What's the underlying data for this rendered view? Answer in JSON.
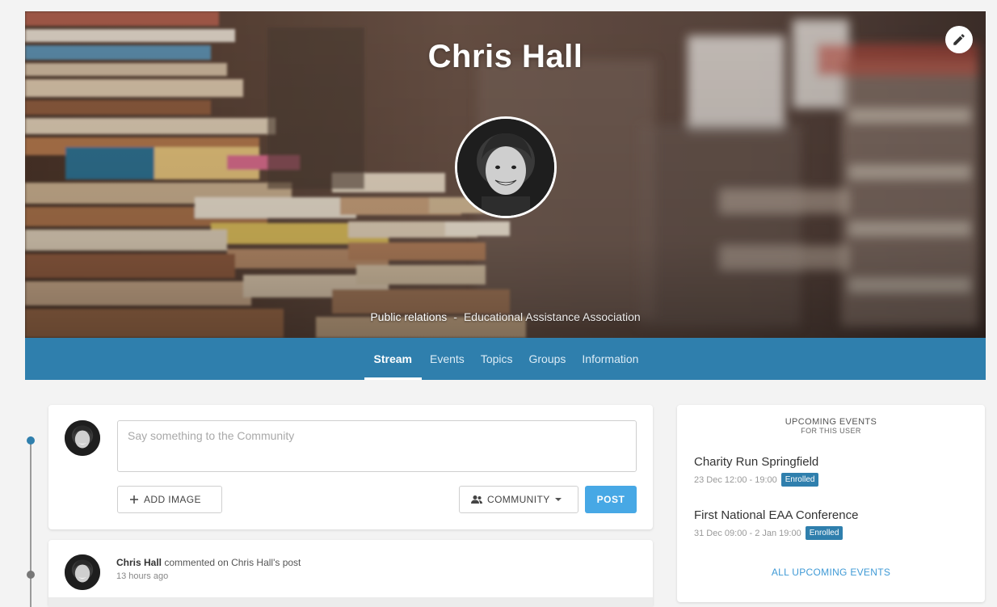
{
  "profile": {
    "name": "Chris Hall",
    "role": "Public relations",
    "separator": "-",
    "organization": "Educational Assistance Association"
  },
  "nav": {
    "tabs": [
      {
        "label": "Stream",
        "active": true
      },
      {
        "label": "Events",
        "active": false
      },
      {
        "label": "Topics",
        "active": false
      },
      {
        "label": "Groups",
        "active": false
      },
      {
        "label": "Information",
        "active": false
      }
    ]
  },
  "composer": {
    "placeholder": "Say something to the Community",
    "add_image_label": "ADD IMAGE",
    "visibility_label": "COMMUNITY",
    "post_label": "POST"
  },
  "activity": {
    "actor": "Chris Hall",
    "action": "commented on Chris Hall's post",
    "time": "13 hours ago"
  },
  "upcoming_events": {
    "heading": "UPCOMING EVENTS",
    "subheading": "FOR THIS USER",
    "items": [
      {
        "title": "Charity Run Springfield",
        "date": "23 Dec 12:00 - 19:00",
        "status": "Enrolled"
      },
      {
        "title": "First National EAA Conference",
        "date": "31 Dec 09:00 - 2 Jan 19:00",
        "status": "Enrolled"
      }
    ],
    "all_link": "ALL UPCOMING EVENTS"
  },
  "colors": {
    "nav_bg": "#2f7fad",
    "post_button": "#47a8e5",
    "badge": "#2f7fad",
    "link": "#3f9ad6",
    "timeline_dot_active": "#2f7fad",
    "timeline_dot": "#777777"
  },
  "icons": {
    "edit": "pencil-icon",
    "add_image": "plus-icon",
    "visibility": "users-icon",
    "dropdown": "caret-down-icon"
  }
}
